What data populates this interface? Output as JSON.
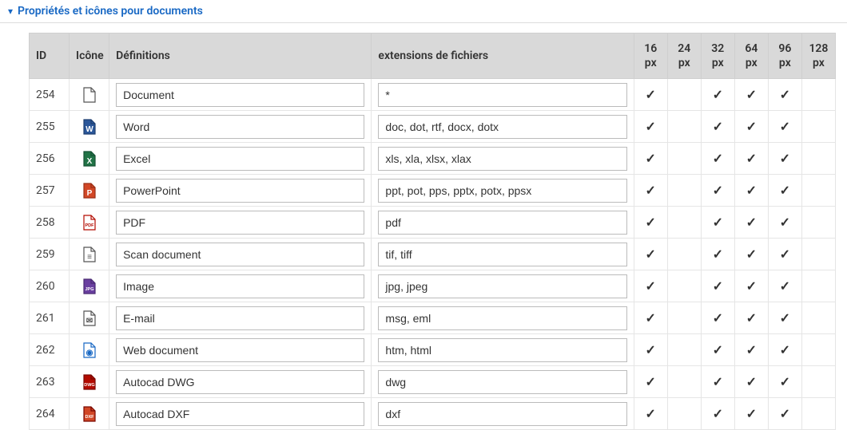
{
  "panel": {
    "title": "Propriétés et icônes pour documents"
  },
  "columns": {
    "id": "ID",
    "icon": "Icône",
    "definitions": "Définitions",
    "extensions": "extensions de fichiers",
    "sizes": [
      {
        "num": "16",
        "unit": "px"
      },
      {
        "num": "24",
        "unit": "px"
      },
      {
        "num": "32",
        "unit": "px"
      },
      {
        "num": "64",
        "unit": "px"
      },
      {
        "num": "96",
        "unit": "px"
      },
      {
        "num": "128",
        "unit": "px"
      }
    ]
  },
  "rows": [
    {
      "id": "254",
      "icon": "document-icon",
      "definition": "Document",
      "extensions": "*",
      "sizes": [
        true,
        false,
        true,
        true,
        true,
        false
      ]
    },
    {
      "id": "255",
      "icon": "word-icon",
      "definition": "Word",
      "extensions": "doc, dot, rtf, docx, dotx",
      "sizes": [
        true,
        false,
        true,
        true,
        true,
        false
      ]
    },
    {
      "id": "256",
      "icon": "excel-icon",
      "definition": "Excel",
      "extensions": "xls, xla, xlsx, xlax",
      "sizes": [
        true,
        false,
        true,
        true,
        true,
        false
      ]
    },
    {
      "id": "257",
      "icon": "powerpoint-icon",
      "definition": "PowerPoint",
      "extensions": "ppt, pot, pps, pptx, potx, ppsx",
      "sizes": [
        true,
        false,
        true,
        true,
        true,
        false
      ]
    },
    {
      "id": "258",
      "icon": "pdf-icon",
      "definition": "PDF",
      "extensions": "pdf",
      "sizes": [
        true,
        false,
        true,
        true,
        true,
        false
      ]
    },
    {
      "id": "259",
      "icon": "scanner-icon",
      "definition": "Scan document",
      "extensions": "tif, tiff",
      "sizes": [
        true,
        false,
        true,
        true,
        true,
        false
      ]
    },
    {
      "id": "260",
      "icon": "image-icon",
      "definition": "Image",
      "extensions": "jpg, jpeg",
      "sizes": [
        true,
        false,
        true,
        true,
        true,
        false
      ]
    },
    {
      "id": "261",
      "icon": "email-icon",
      "definition": "E-mail",
      "extensions": "msg, eml",
      "sizes": [
        true,
        false,
        true,
        true,
        true,
        false
      ]
    },
    {
      "id": "262",
      "icon": "web-icon",
      "definition": "Web document",
      "extensions": "htm, html",
      "sizes": [
        true,
        false,
        true,
        true,
        true,
        false
      ]
    },
    {
      "id": "263",
      "icon": "dwg-icon",
      "definition": "Autocad DWG",
      "extensions": "dwg",
      "sizes": [
        true,
        false,
        true,
        true,
        true,
        false
      ]
    },
    {
      "id": "264",
      "icon": "dxf-icon",
      "definition": "Autocad DXF",
      "extensions": "dxf",
      "sizes": [
        true,
        false,
        true,
        true,
        true,
        false
      ]
    }
  ],
  "icon_colors": {
    "document-icon": {
      "fill": "#ffffff",
      "stroke": "#555555",
      "text": "",
      "textcolor": "#555555"
    },
    "word-icon": {
      "fill": "#2b579a",
      "stroke": "#1e3f70",
      "text": "W",
      "textcolor": "#ffffff"
    },
    "excel-icon": {
      "fill": "#217346",
      "stroke": "#155133",
      "text": "X",
      "textcolor": "#ffffff"
    },
    "powerpoint-icon": {
      "fill": "#d24726",
      "stroke": "#9a2f16",
      "text": "P",
      "textcolor": "#ffffff"
    },
    "pdf-icon": {
      "fill": "#ffffff",
      "stroke": "#b30b00",
      "text": "PDF",
      "textcolor": "#b30b00"
    },
    "scanner-icon": {
      "fill": "#ffffff",
      "stroke": "#555555",
      "text": "≡",
      "textcolor": "#555555"
    },
    "image-icon": {
      "fill": "#6a3fa0",
      "stroke": "#4a2a73",
      "text": "JPG",
      "textcolor": "#ffffff"
    },
    "email-icon": {
      "fill": "#ffffff",
      "stroke": "#555555",
      "text": "✉",
      "textcolor": "#555555"
    },
    "web-icon": {
      "fill": "#ffffff",
      "stroke": "#1868c4",
      "text": "◉",
      "textcolor": "#1868c4"
    },
    "dwg-icon": {
      "fill": "#b30b00",
      "stroke": "#7a0800",
      "text": "DWG",
      "textcolor": "#ffffff"
    },
    "dxf-icon": {
      "fill": "#d24726",
      "stroke": "#7a0800",
      "text": "DXF",
      "textcolor": "#ffffff"
    }
  }
}
